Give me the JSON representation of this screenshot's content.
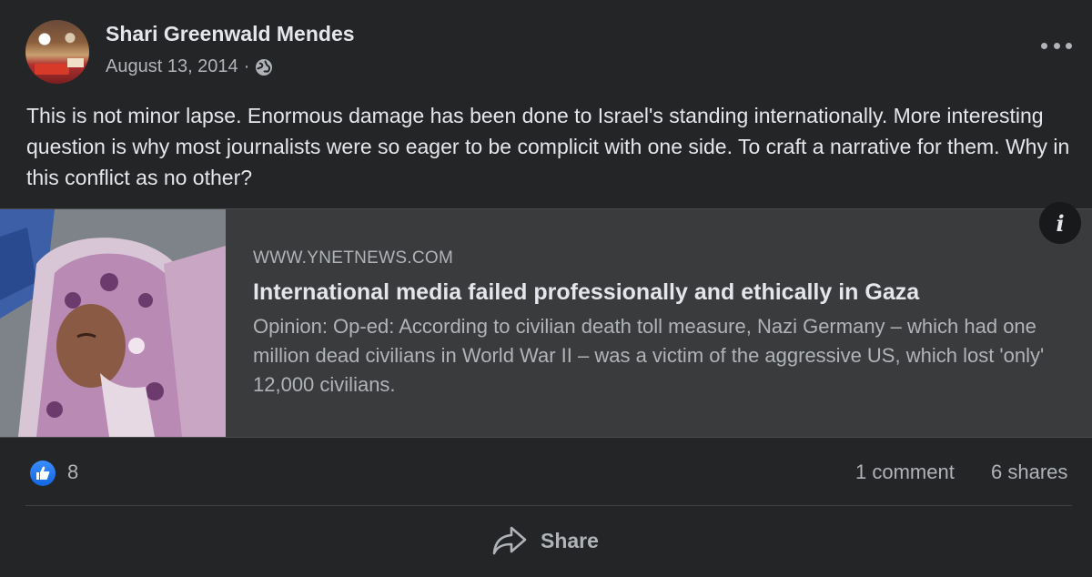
{
  "post": {
    "author": "Shari Greenwald Mendes",
    "date": "August 13, 2014",
    "separator": "·",
    "privacy_icon": "globe-icon",
    "text": "This is not minor lapse. Enormous damage has been done to Israel's standing internationally. More interesting question is why most journalists were so eager to be complicit with one side. To craft a narrative for them. Why in this conflict as no other?"
  },
  "link": {
    "domain": "WWW.YNETNEWS.COM",
    "title": "International media failed professionally and ethically in Gaza",
    "description": "Opinion: Op-ed: According to civilian death toll measure, Nazi Germany – which had one million dead civilians in World War II – was a victim of the aggressive US, which lost 'only' 12,000 civilians.",
    "info_icon_text": "i"
  },
  "reactions": {
    "likes": "8",
    "comments": "1 comment",
    "shares": "6 shares"
  },
  "actions": {
    "share_label": "Share"
  },
  "colors": {
    "background": "#242526",
    "card": "#3a3b3c",
    "like_blue": "#1877f2",
    "text_primary": "#e4e6eb",
    "text_secondary": "#b0b3b8"
  }
}
